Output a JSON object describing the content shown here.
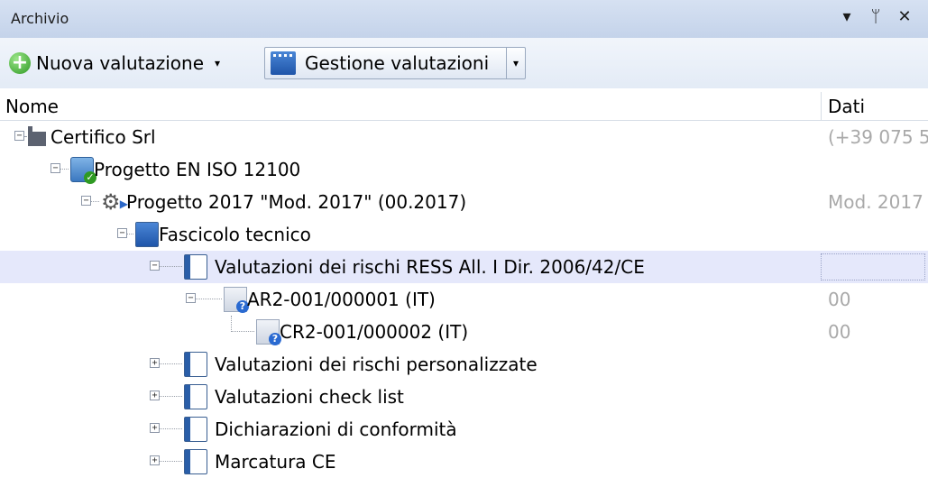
{
  "window": {
    "title": "Archivio",
    "dropdown_glyph": "▾",
    "pin_glyph": "ᛘ",
    "close_glyph": "✕"
  },
  "toolbar": {
    "new_label": "Nuova valutazione",
    "manage_label": "Gestione valutazioni",
    "dropdown_glyph": "▾"
  },
  "columns": {
    "name": "Nome",
    "data": "Dati"
  },
  "tree": [
    {
      "label": "Certifico Srl",
      "data": "(+39 075 5",
      "icon": "factory-icon",
      "expander": "minus"
    },
    {
      "label": "Progetto EN ISO 12100",
      "data": "",
      "icon": "project-icon",
      "expander": "minus"
    },
    {
      "label": "Progetto 2017 \"Mod. 2017\" (00.2017)",
      "data": "Mod. 2017",
      "icon": "gear-icon",
      "expander": "minus"
    },
    {
      "label": "Fascicolo tecnico",
      "data": "",
      "icon": "folder-book-icon",
      "expander": "minus"
    },
    {
      "label": "Valutazioni dei rischi RESS All. I Dir. 2006/42/CE",
      "data": "",
      "icon": "folder-book-icon",
      "expander": "minus",
      "selected": true
    },
    {
      "label": "AR2-001/000001 (IT)",
      "data": "00",
      "icon": "document-question-icon",
      "expander": "minus"
    },
    {
      "label": "CR2-001/000002 (IT)",
      "data": "00",
      "icon": "document-question-icon",
      "expander": "none"
    },
    {
      "label": "Valutazioni dei rischi personalizzate",
      "data": "",
      "icon": "folder-book-icon",
      "expander": "plus"
    },
    {
      "label": "Valutazioni check list",
      "data": "",
      "icon": "folder-book-icon",
      "expander": "plus"
    },
    {
      "label": "Dichiarazioni di conformità",
      "data": "",
      "icon": "folder-book-icon",
      "expander": "plus"
    },
    {
      "label": "Marcatura CE",
      "data": "",
      "icon": "folder-book-icon",
      "expander": "plus"
    }
  ],
  "expander_glyphs": {
    "minus": "−",
    "plus": "+"
  },
  "colors": {
    "selection": "#e5e8fb",
    "accent": "#1f55a9",
    "data_text": "#a9a9a9"
  }
}
